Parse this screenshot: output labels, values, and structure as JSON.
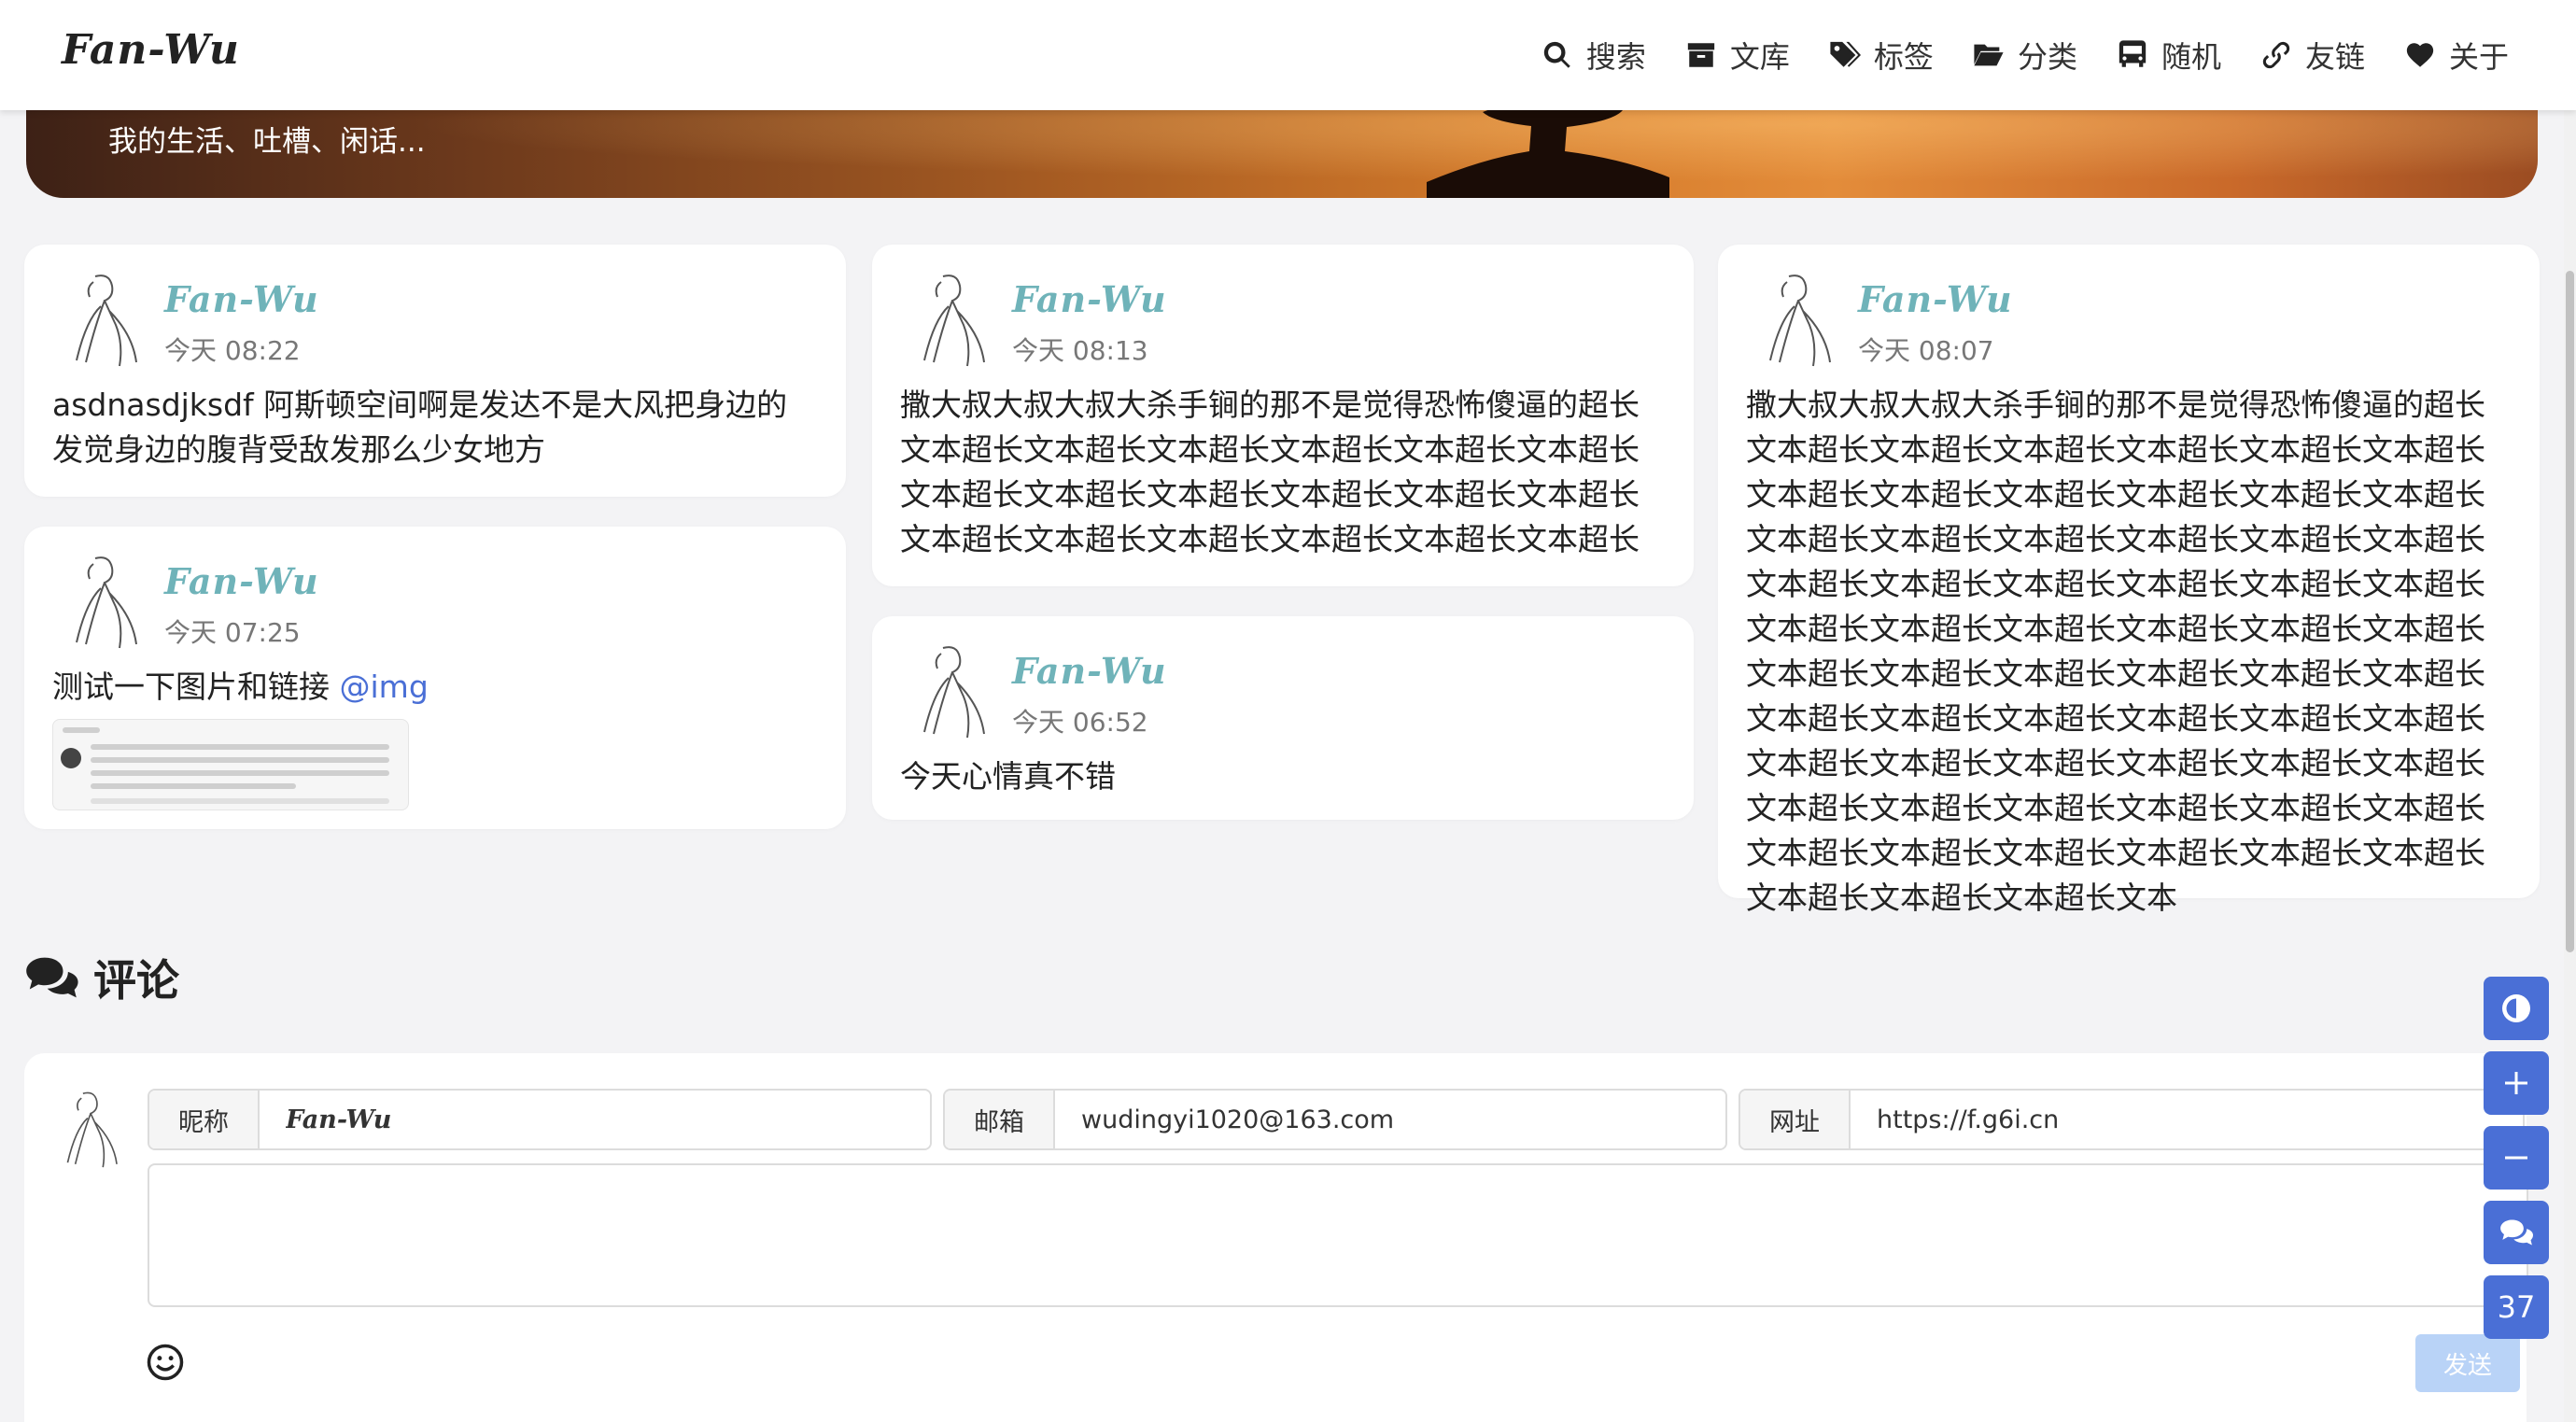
{
  "brand": "Fan-Wu",
  "nav": [
    {
      "icon": "search-icon",
      "label": "搜索"
    },
    {
      "icon": "archive-icon",
      "label": "文库"
    },
    {
      "icon": "tags-icon",
      "label": "标签"
    },
    {
      "icon": "folder-open-icon",
      "label": "分类"
    },
    {
      "icon": "bus-icon",
      "label": "随机"
    },
    {
      "icon": "link-icon",
      "label": "友链"
    },
    {
      "icon": "heart-icon",
      "label": "关于"
    }
  ],
  "banner": {
    "subtitle": "我的生活、吐槽、闲话..."
  },
  "moments": [
    {
      "author": "Fan-Wu",
      "time": "今天 08:22",
      "text": "asdnasdjksdf 阿斯顿空间啊是发达不是大风把身边的发觉身边的腹背受敌发那么少女地方"
    },
    {
      "author": "Fan-Wu",
      "time": "今天 07:25",
      "text": "测试一下图片和链接",
      "link": "@img"
    },
    {
      "author": "Fan-Wu",
      "time": "今天 08:13",
      "text": "撒大叔大叔大叔大杀手锏的那不是觉得恐怖傻逼的超长文本超长文本超长文本超长文本超长文本超长文本超长文本超长文本超长文本超长文本超长文本超长文本超长文本超长文本超长文本超长文本超长文本超长文本超长"
    },
    {
      "author": "Fan-Wu",
      "time": "今天 06:52",
      "text": "今天心情真不错"
    },
    {
      "author": "Fan-Wu",
      "time": "今天 08:07",
      "text": "撒大叔大叔大叔大杀手锏的那不是觉得恐怖傻逼的超长文本超长文本超长文本超长文本超长文本超长文本超长文本超长文本超长文本超长文本超长文本超长文本超长文本超长文本超长文本超长文本超长文本超长文本超长文本超长文本超长文本超长文本超长文本超长文本超长文本超长文本超长文本超长文本超长文本超长文本超长文本超长文本超长文本超长文本超长文本超长文本超长文本超长文本超长文本超长文本超长文本超长文本超长文本超长文本超长文本超长文本超长文本超长文本超长文本超长文本超长文本超长文本超长文本超长文本超长文本超长文本超长文本超长文本超长文本超长文本超长文本超长文本超长文本超长文本"
    }
  ],
  "comments": {
    "title": "评论",
    "nickname_label": "昵称",
    "nickname_value": "Fan-Wu",
    "email_label": "邮箱",
    "email_value": "wudingyi1020@163.com",
    "url_label": "网址",
    "url_value": "https://f.g6i.cn",
    "textarea_value": "",
    "send_label": "发送"
  },
  "floating": {
    "buttons": [
      "theme-toggle-icon",
      "zoom-in-icon",
      "zoom-out-icon",
      "comments-icon"
    ],
    "count": "37"
  },
  "colors": {
    "accent": "#4a6fd6",
    "author": "#6fb3b9",
    "send_disabled": "#b9d3f7",
    "page_bg": "#f3f3f5"
  }
}
